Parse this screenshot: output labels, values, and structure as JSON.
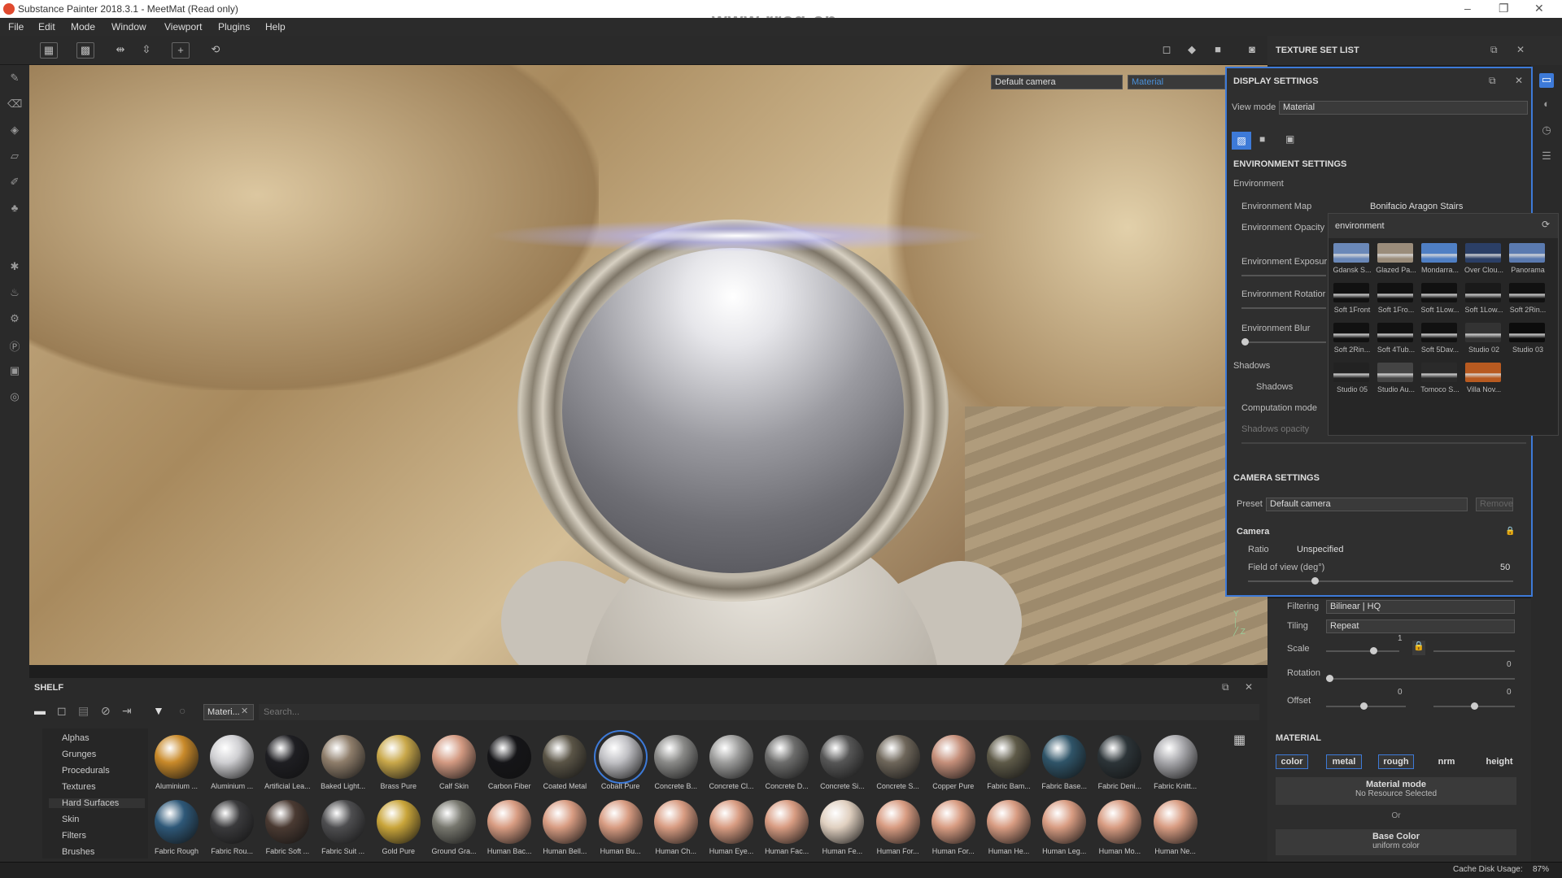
{
  "window": {
    "title": "Substance Painter 2018.3.1 - MeetMat (Read only)",
    "watermark": "www.rrcg.cn"
  },
  "menu": [
    "File",
    "Edit",
    "Mode",
    "Window",
    "Viewport",
    "Plugins",
    "Help"
  ],
  "viewport": {
    "camera": "Default camera",
    "channel": "Material"
  },
  "texture_set_list": {
    "title": "TEXTURE SET LIST"
  },
  "display_settings": {
    "title": "DISPLAY SETTINGS",
    "view_mode_label": "View mode",
    "view_mode": "Material",
    "env_title": "ENVIRONMENT SETTINGS",
    "env_group": "Environment",
    "env_map_label": "Environment Map",
    "env_map": "Bonifacio Aragon Stairs",
    "env_opacity": "Environment Opacity",
    "env_exposure": "Environment Exposur",
    "env_rotation": "Environment Rotatior",
    "env_blur": "Environment Blur",
    "shadows_group": "Shadows",
    "shadows": "Shadows",
    "computation": "Computation mode",
    "shadows_opacity": "Shadows opacity",
    "cam_title": "CAMERA SETTINGS",
    "preset_label": "Preset",
    "preset": "Default camera",
    "remove": "Remove",
    "camera_group": "Camera",
    "ratio_label": "Ratio",
    "ratio": "Unspecified",
    "fov_label": "Field of view (deg°)",
    "fov": "50",
    "fov_level": 0.25
  },
  "env_popup": {
    "search": "environment",
    "items": [
      {
        "label": "Gdansk S...",
        "tone": "#6a88b8"
      },
      {
        "label": "Glazed Pa...",
        "tone": "#9a8c7a"
      },
      {
        "label": "Mondarra...",
        "tone": "#4f7fc4"
      },
      {
        "label": "Over Clou...",
        "tone": "#2b3f66"
      },
      {
        "label": "Panorama",
        "tone": "#5a7ab0"
      },
      {
        "label": "Soft 1Front",
        "tone": "#111111"
      },
      {
        "label": "Soft 1Fro...",
        "tone": "#111111"
      },
      {
        "label": "Soft 1Low...",
        "tone": "#111111"
      },
      {
        "label": "Soft 1Low...",
        "tone": "#1a1a1a"
      },
      {
        "label": "Soft 2Rin...",
        "tone": "#111111"
      },
      {
        "label": "Soft 2Rin...",
        "tone": "#111111"
      },
      {
        "label": "Soft 4Tub...",
        "tone": "#111111"
      },
      {
        "label": "Soft 5Dav...",
        "tone": "#111111"
      },
      {
        "label": "Studio 02",
        "tone": "#333333"
      },
      {
        "label": "Studio 03",
        "tone": "#0c0c0c"
      },
      {
        "label": "Studio 05",
        "tone": "#222222"
      },
      {
        "label": "Studio Au...",
        "tone": "#444444"
      },
      {
        "label": "Tomoco S...",
        "tone": "#2a2a2a"
      },
      {
        "label": "Villa Nov...",
        "tone": "#b85a20"
      }
    ]
  },
  "properties": {
    "filtering_label": "Filtering",
    "filtering": "Bilinear | HQ",
    "tiling_label": "Tiling",
    "tiling": "Repeat",
    "scale_label": "Scale",
    "scale": "1",
    "rotation_label": "Rotation",
    "rotation": "0",
    "offset_label": "Offset",
    "offset_x": "0",
    "offset_y": "0",
    "material_title": "MATERIAL",
    "channels": [
      "color",
      "metal",
      "rough",
      "nrm",
      "height"
    ],
    "material_mode": "Material mode",
    "no_resource": "No Resource Selected",
    "or": "Or",
    "base_color": "Base Color",
    "uniform": "uniform color"
  },
  "shelf": {
    "title": "SHELF",
    "filter_tag": "Materi...",
    "search_placeholder": "Search...",
    "categories": [
      "Alphas",
      "Grunges",
      "Procedurals",
      "Textures",
      "Hard Surfaces",
      "Skin",
      "Filters",
      "Brushes"
    ],
    "row1": [
      {
        "label": "Aluminium ...",
        "color": "#c98a2a"
      },
      {
        "label": "Aluminium ...",
        "color": "#cfcfd2"
      },
      {
        "label": "Artificial Lea...",
        "color": "#1e1e22"
      },
      {
        "label": "Baked Light...",
        "color": "#8e7d6a"
      },
      {
        "label": "Brass Pure",
        "color": "#c9a84a"
      },
      {
        "label": "Calf Skin",
        "color": "#d39a82"
      },
      {
        "label": "Carbon Fiber",
        "color": "#151518"
      },
      {
        "label": "Coated Metal",
        "color": "#5a5446"
      },
      {
        "label": "Cobalt Pure",
        "color": "#c0c0c4"
      },
      {
        "label": "Concrete B...",
        "color": "#8a8a88"
      },
      {
        "label": "Concrete Cl...",
        "color": "#9d9d9c"
      },
      {
        "label": "Concrete D...",
        "color": "#6d6d6c"
      },
      {
        "label": "Concrete Si...",
        "color": "#565656"
      },
      {
        "label": "Concrete S...",
        "color": "#6e665a"
      },
      {
        "label": "Copper Pure",
        "color": "#c58f7a"
      },
      {
        "label": "Fabric Bam...",
        "color": "#5e5a48"
      },
      {
        "label": "Fabric Base...",
        "color": "#2f5468"
      },
      {
        "label": "Fabric Deni...",
        "color": "#2c3438"
      },
      {
        "label": "Fabric Knitt...",
        "color": "#a8a8ac"
      }
    ],
    "row2": [
      {
        "label": "Fabric Rough",
        "color": "#2e5878"
      },
      {
        "label": "Fabric Rou...",
        "color": "#3a3a3c"
      },
      {
        "label": "Fabric Soft ...",
        "color": "#4a3a32"
      },
      {
        "label": "Fabric Suit ...",
        "color": "#4e4e50"
      },
      {
        "label": "Gold Pure",
        "color": "#c9a53a"
      },
      {
        "label": "Ground Gra...",
        "color": "#77776e"
      },
      {
        "label": "Human Bac...",
        "color": "#d89c82"
      },
      {
        "label": "Human Bell...",
        "color": "#d89c82"
      },
      {
        "label": "Human Bu...",
        "color": "#d89c82"
      },
      {
        "label": "Human Ch...",
        "color": "#d89c82"
      },
      {
        "label": "Human Eye...",
        "color": "#d89c82"
      },
      {
        "label": "Human Fac...",
        "color": "#d89c82"
      },
      {
        "label": "Human Fe...",
        "color": "#e0d0c0"
      },
      {
        "label": "Human For...",
        "color": "#d89c82"
      },
      {
        "label": "Human For...",
        "color": "#d89c82"
      },
      {
        "label": "Human He...",
        "color": "#d89c82"
      },
      {
        "label": "Human Leg...",
        "color": "#d89c82"
      },
      {
        "label": "Human Mo...",
        "color": "#d89c82"
      },
      {
        "label": "Human Ne...",
        "color": "#d89c82"
      }
    ]
  },
  "status": {
    "cache": "Cache Disk Usage:",
    "cache_value": "87%"
  }
}
